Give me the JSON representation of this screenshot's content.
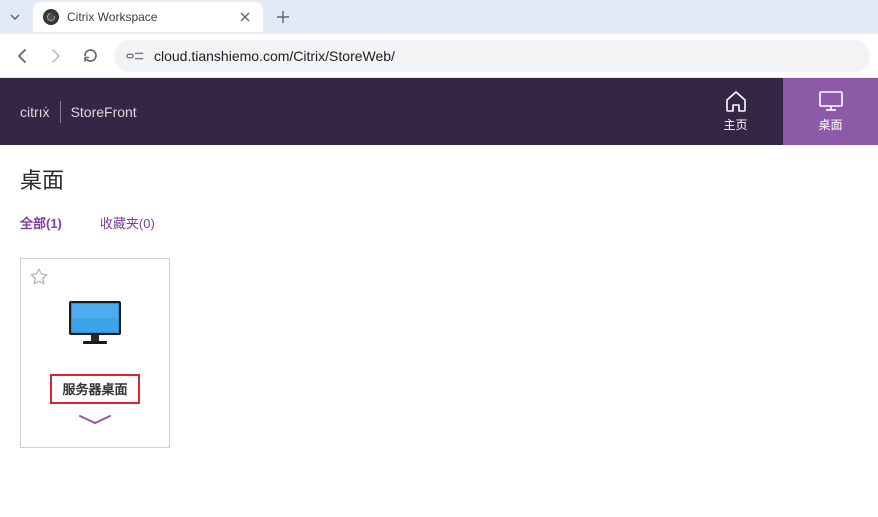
{
  "browser": {
    "tab_title": "Citrix Workspace",
    "url": "cloud.tianshiemo.com/Citrix/StoreWeb/"
  },
  "header": {
    "logo": "citrıẋ",
    "product": "StoreFront",
    "nav": {
      "home": {
        "label": "主页"
      },
      "desktops": {
        "label": "桌面"
      }
    }
  },
  "page": {
    "title": "桌面",
    "tabs": {
      "all": "全部(1)",
      "favorites": "收藏夹(0)"
    }
  },
  "card": {
    "label": "服务器桌面"
  }
}
